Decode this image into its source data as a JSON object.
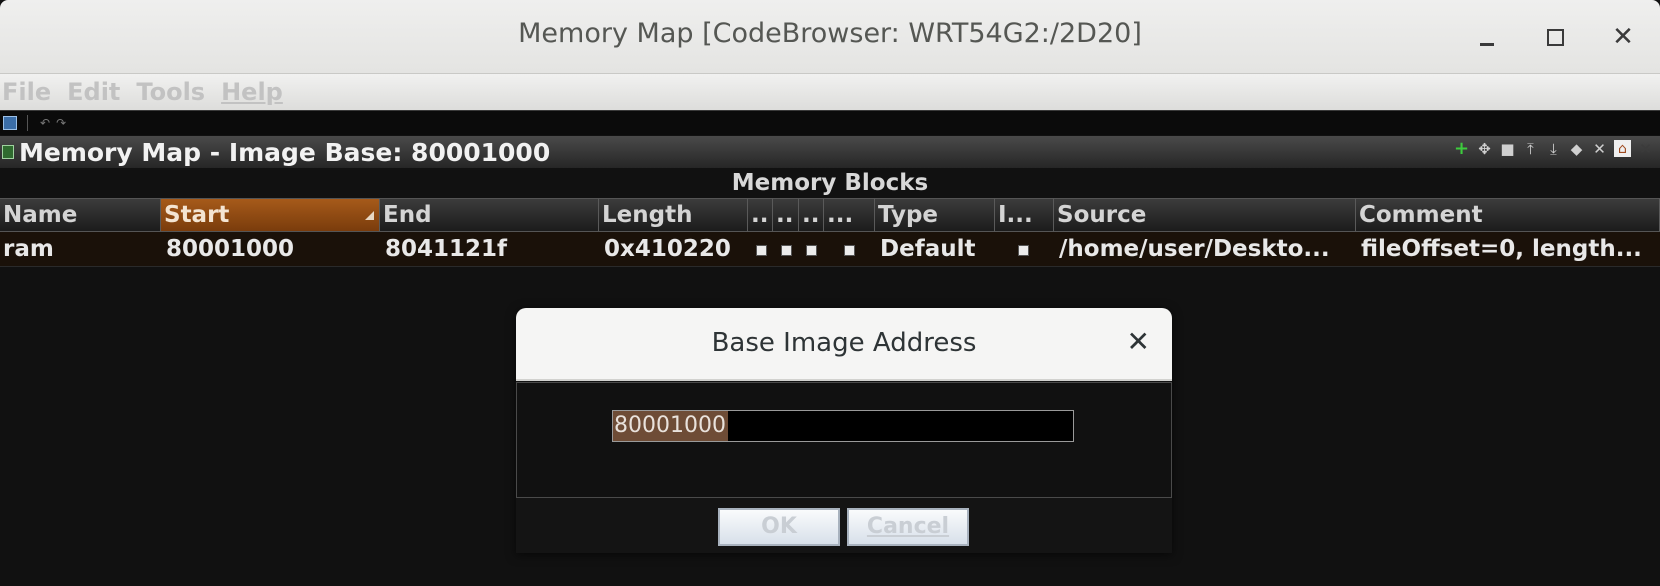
{
  "window": {
    "title": "Memory Map [CodeBrowser: WRT54G2:/2D20]"
  },
  "menu": [
    "File",
    "Edit",
    "Tools",
    "Help"
  ],
  "panel": {
    "title": "Memory Map - Image Base: 80001000"
  },
  "table": {
    "caption": "Memory Blocks",
    "columns": [
      "Name",
      "Start",
      "End",
      "Length",
      "..",
      "..",
      "..",
      "...",
      "Type",
      "I...",
      "Source",
      "Comment"
    ],
    "sorted_column": "Start",
    "rows": [
      {
        "name": "ram",
        "start": "80001000",
        "end": "8041121f",
        "length": "0x410220",
        "type": "Default",
        "source": "/home/user/Deskto...",
        "comment": "fileOffset=0, length..."
      }
    ]
  },
  "dialog": {
    "title": "Base Image Address",
    "address_value": "80001000",
    "ok_label": "OK",
    "cancel_label": "Cancel"
  }
}
